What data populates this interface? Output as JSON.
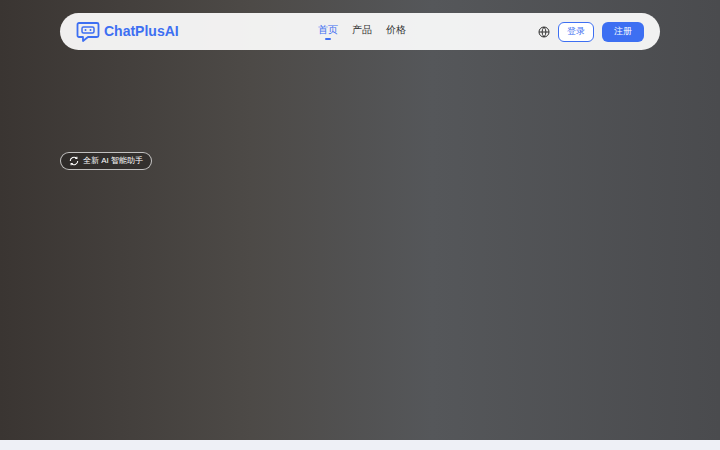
{
  "navbar": {
    "logo": "ChatPlusAI",
    "items": [
      {
        "label": "首页",
        "selected": true
      },
      {
        "label": "产品",
        "selected": false
      },
      {
        "label": "价格",
        "selected": false
      }
    ],
    "login": "登录",
    "register": "注册"
  },
  "hero": {
    "badge": "全新 AI 智能助手"
  }
}
